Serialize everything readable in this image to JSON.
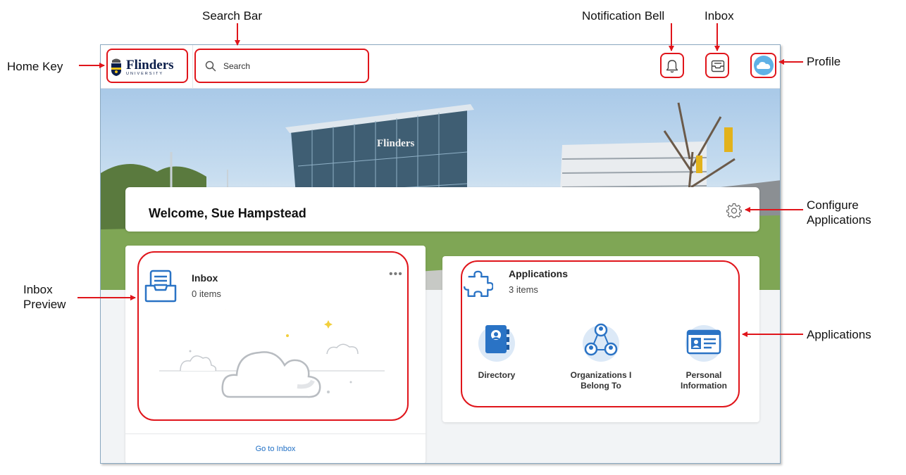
{
  "annotations": {
    "search_bar": "Search Bar",
    "notification_bell": "Notification Bell",
    "inbox": "Inbox",
    "home_key": "Home Key",
    "profile": "Profile",
    "configure_line1": "Configure",
    "configure_line2": "Applications",
    "inbox_preview_line1": "Inbox",
    "inbox_preview_line2": "Preview",
    "applications": "Applications"
  },
  "header": {
    "logo_name": "Flinders",
    "logo_sub": "UNIVERSITY",
    "search_placeholder": "Search"
  },
  "hero": {
    "building_sign": "Flinders"
  },
  "welcome": {
    "text": "Welcome, Sue Hampstead"
  },
  "inbox_card": {
    "title": "Inbox",
    "count": "0 items",
    "more": "•••",
    "link": "Go to Inbox"
  },
  "apps_card": {
    "title": "Applications",
    "count": "3 items",
    "items": [
      {
        "label_line1": "Directory",
        "label_line2": ""
      },
      {
        "label_line1": "Organizations I",
        "label_line2": "Belong To"
      },
      {
        "label_line1": "Personal",
        "label_line2": "Information"
      }
    ]
  },
  "colors": {
    "annotation_red": "#e0151b",
    "brand_navy": "#0b1e4a",
    "icon_blue": "#2a73c5",
    "link_blue": "#1f6fc5"
  }
}
